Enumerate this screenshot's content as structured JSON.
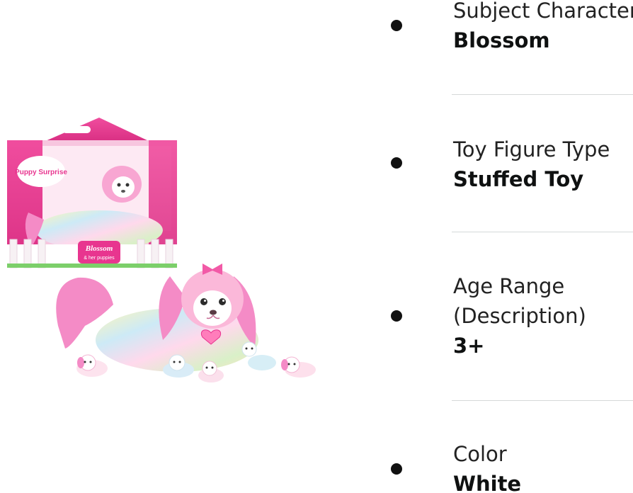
{
  "product": {
    "image_alt": "Puppy Surprise Blossom plush with box and puppies",
    "box_brand_text": "Puppy Surprise",
    "box_name_text": "Blossom",
    "box_sub_text": "& her puppies"
  },
  "attributes": [
    {
      "label": "Subject Character",
      "value": "Blossom"
    },
    {
      "label": "Toy Figure Type",
      "value": "Stuffed Toy"
    },
    {
      "label": "Age Range\n(Description)",
      "label_line1": "Age Range",
      "label_line2": "(Description)",
      "value": "3+"
    },
    {
      "label": "Color",
      "value": "White"
    }
  ],
  "colors": {
    "bullet": "#111111",
    "divider": "#d5d9d9",
    "box_pink": "#e8358f",
    "plush_pink": "#f48bc6"
  }
}
